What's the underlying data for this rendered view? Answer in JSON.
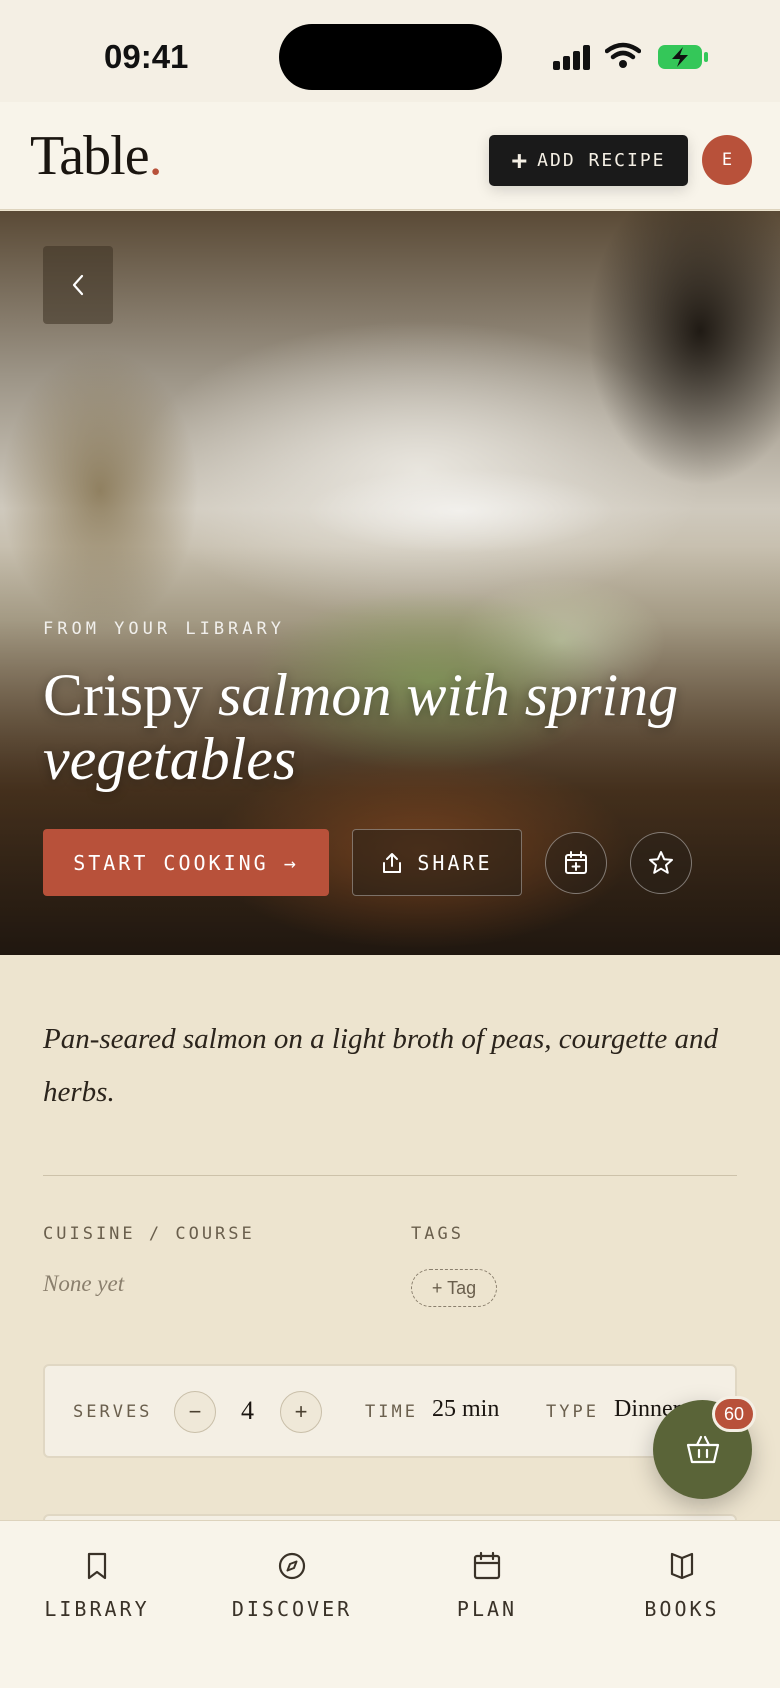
{
  "status_bar": {
    "time": "09:41"
  },
  "header": {
    "logo_text": "Table",
    "logo_dot": ".",
    "add_recipe_icon": "+",
    "add_recipe_label": "ADD RECIPE",
    "avatar_initial": "E"
  },
  "hero": {
    "eyebrow": "FROM YOUR LIBRARY",
    "title_plain": "Crispy",
    "title_italic": "salmon with spring vegetables",
    "start_cooking_label": "START COOKING →",
    "share_label": "SHARE",
    "icons": [
      "chevron-left-icon",
      "share-icon",
      "calendar-plus-icon",
      "star-icon"
    ]
  },
  "recipe": {
    "description": "Pan-seared salmon on a light broth of peas, courgette and herbs.",
    "cuisine_label": "CUISINE / COURSE",
    "cuisine_value": "None yet",
    "tags_label": "TAGS",
    "add_tag_label": "+ Tag"
  },
  "info": {
    "serves_label": "SERVES",
    "serves_value": "4",
    "decrement": "−",
    "increment": "+",
    "time_label": "TIME",
    "time_value": "25 min",
    "type_label": "TYPE",
    "type_value": "Dinner"
  },
  "basket": {
    "count": "60",
    "icon": "basket-icon"
  },
  "tabs": [
    {
      "label": "LIBRARY",
      "icon": "bookmark-icon"
    },
    {
      "label": "DISCOVER",
      "icon": "compass-icon"
    },
    {
      "label": "PLAN",
      "icon": "calendar-icon"
    },
    {
      "label": "BOOKS",
      "icon": "book-icon"
    }
  ],
  "colors": {
    "accent": "#b8513a",
    "background": "#ede4cf",
    "basket": "#5a6438",
    "dark_button": "#1a1a1a"
  }
}
